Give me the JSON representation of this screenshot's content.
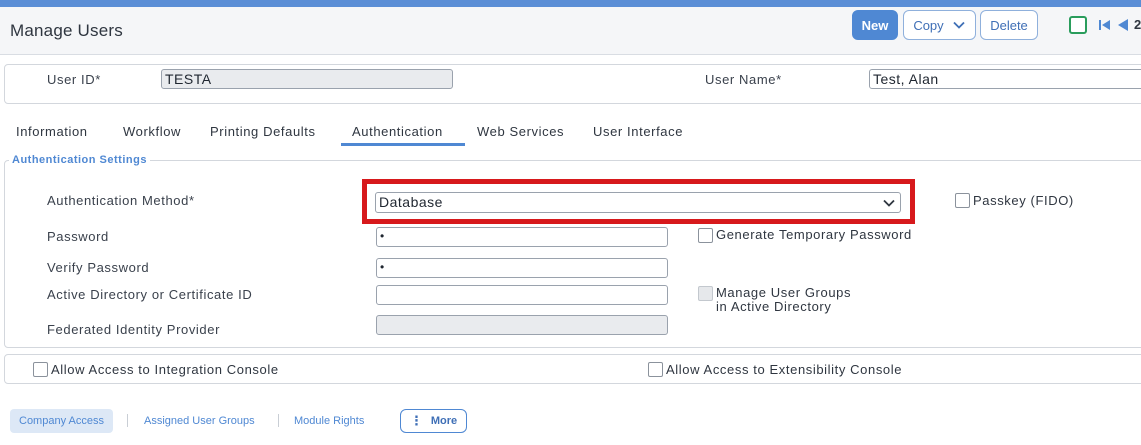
{
  "header": {
    "title": "Manage Users",
    "new_label": "New",
    "copy_label": "Copy",
    "delete_label": "Delete",
    "record_count": "2"
  },
  "user": {
    "id_label": "User ID*",
    "id_value": "TESTA",
    "name_label": "User Name*",
    "name_value": "Test, Alan"
  },
  "tabs": [
    {
      "label": "Information"
    },
    {
      "label": "Workflow"
    },
    {
      "label": "Printing Defaults"
    },
    {
      "label": "Authentication",
      "active": true
    },
    {
      "label": "Web Services"
    },
    {
      "label": "User Interface"
    }
  ],
  "auth": {
    "legend": "Authentication Settings",
    "method_label": "Authentication Method*",
    "method_value": "Database",
    "passkey_label": "Passkey (FIDO)",
    "password_label": "Password",
    "password_value": "•",
    "generate_temp_label": "Generate Temporary Password",
    "verify_label": "Verify Password",
    "verify_value": "•",
    "ad_label": "Active Directory or Certificate ID",
    "ad_value": "",
    "manage_groups_line1": "Manage User Groups",
    "manage_groups_line2": "in Active Directory",
    "federated_label": "Federated Identity Provider",
    "federated_value": ""
  },
  "access": {
    "integration_label": "Allow Access to Integration Console",
    "extensibility_label": "Allow Access to Extensibility Console"
  },
  "bottom_tabs": {
    "company_access": "Company Access",
    "assigned_groups": "Assigned User Groups",
    "module_rights": "Module Rights",
    "more": "More"
  },
  "colors": {
    "accent": "#4f88d3",
    "highlight": "#d7191c",
    "record_icon": "#2a9d5c"
  },
  "icons": {
    "copy_dropdown": "chevron-down-icon",
    "select_dropdown": "chevron-down-icon",
    "record_status": "square-icon",
    "nav_first": "skip-first-icon",
    "nav_prev": "triangle-left-icon",
    "more": "vertical-dots-icon"
  }
}
